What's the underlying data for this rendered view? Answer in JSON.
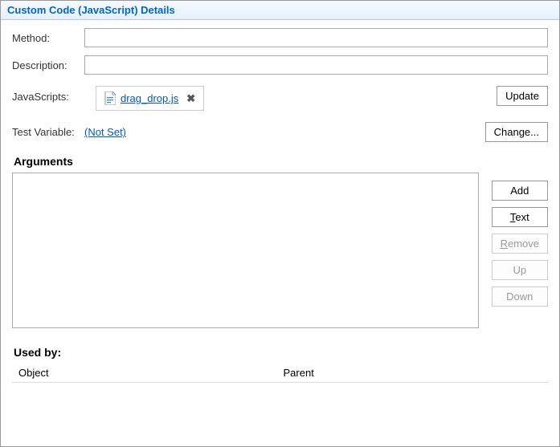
{
  "header": {
    "title": "Custom Code (JavaScript) Details"
  },
  "form": {
    "method_label": "Method:",
    "method_value": "",
    "description_label": "Description:",
    "description_value": "",
    "javascripts_label": "JavaScripts:",
    "js_file": "drag_drop.js",
    "update_label": "Update",
    "test_variable_label": "Test Variable:",
    "test_variable_value": "(Not Set)",
    "change_label": "Change..."
  },
  "arguments": {
    "title": "Arguments",
    "buttons": {
      "add": "Add",
      "text_pre": "T",
      "text_post": "ext",
      "remove_pre": "R",
      "remove_post": "emove",
      "up": "Up",
      "down": "Down"
    }
  },
  "used_by": {
    "title": "Used by:",
    "col_object": "Object",
    "col_parent": "Parent"
  }
}
